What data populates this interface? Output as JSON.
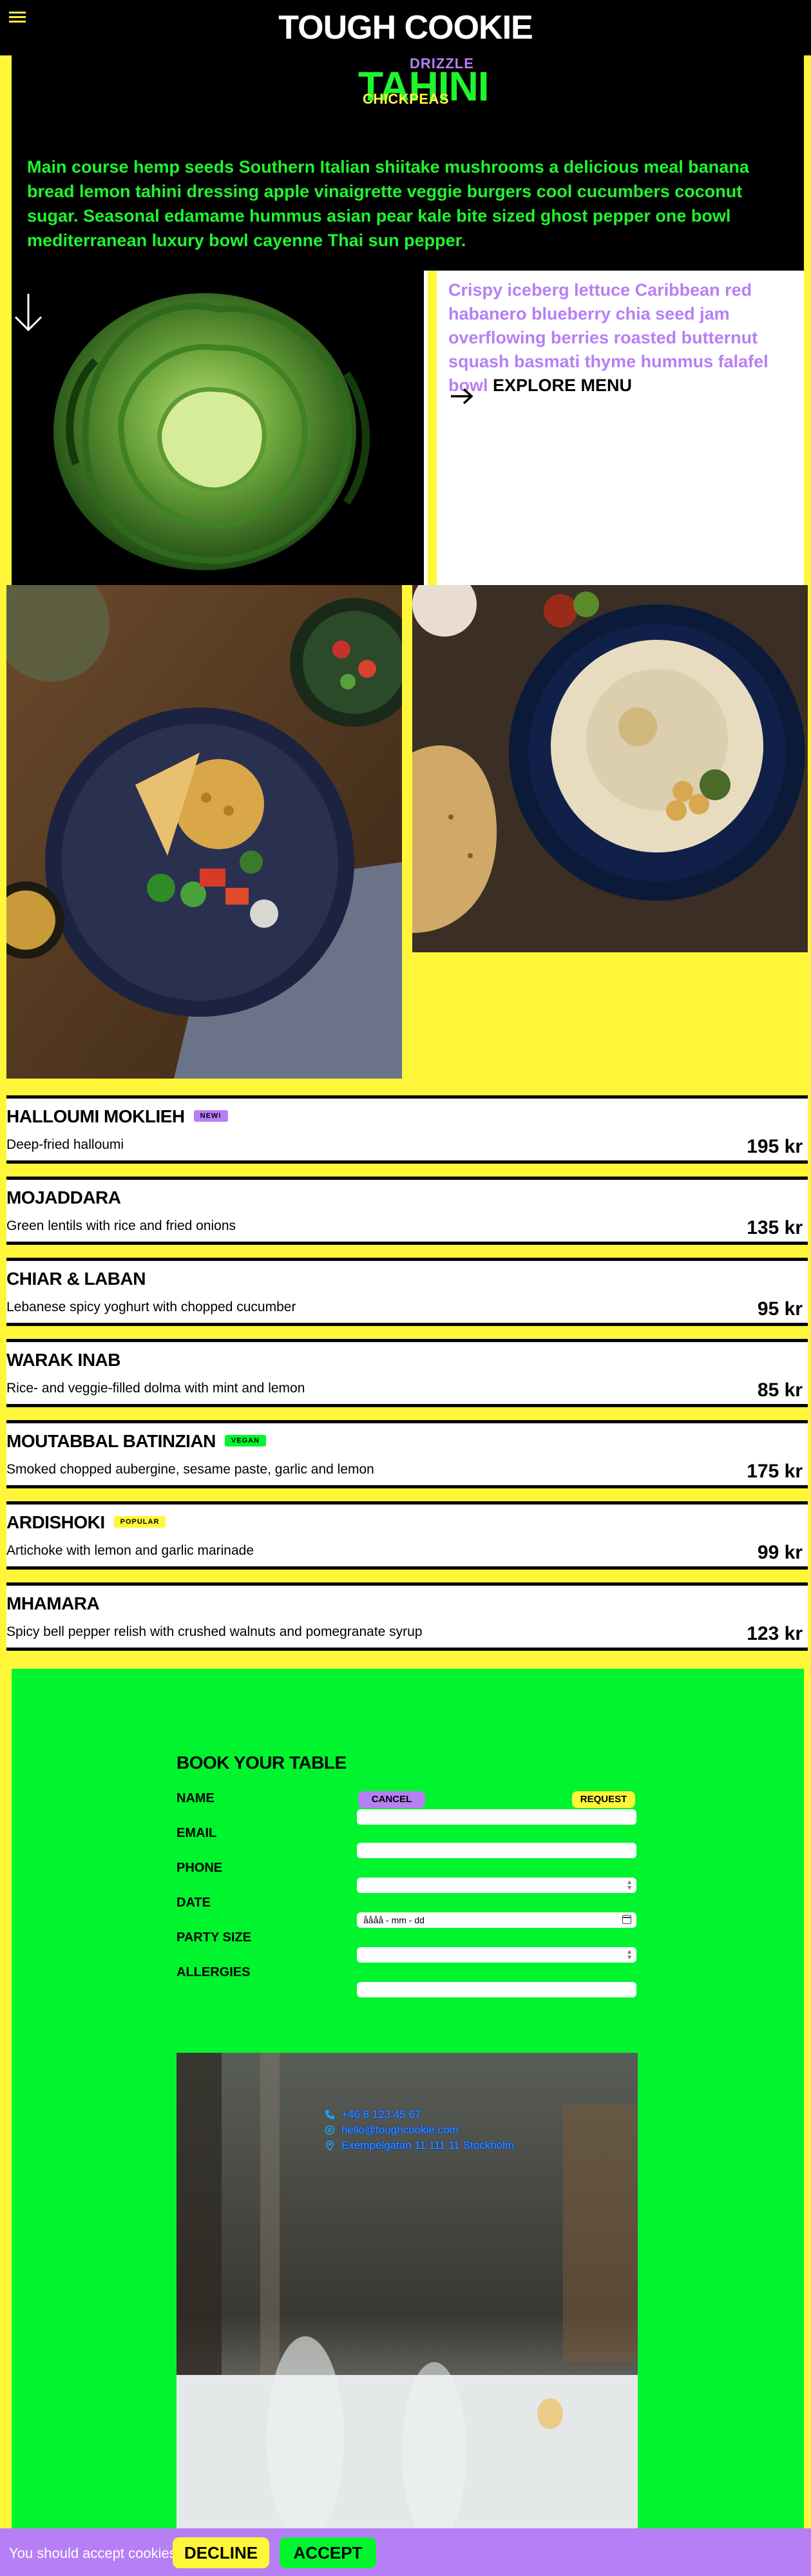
{
  "header": {
    "brand": "TOUGH COOKIE",
    "logo": {
      "top": "DRIZZLE",
      "main": "TAHINI",
      "bottom": "CHICKPEAS"
    }
  },
  "hero": {
    "text": "Main course hemp seeds Southern Italian shiitake mushrooms a delicious meal banana bread lemon tahini dressing apple vinaigrette veggie burgers cool cucumbers coconut sugar. Seasonal edamame hummus asian pear kale bite sized ghost pepper one bowl mediterranean luxury bowl cayenne Thai sun pepper.",
    "teaser": "Crispy iceberg lettuce Caribbean red habanero blueberry chia seed jam overflowing berries roasted butternut squash basmati thyme hummus falafel bowl",
    "explore_label": "EXPLORE MENU"
  },
  "menu": {
    "items": [
      {
        "name": "HALLOUMI MOKLIEH",
        "badge": "NEW!",
        "badge_color": "#b77ff5",
        "desc": "Deep-fried halloumi",
        "price": "195 kr"
      },
      {
        "name": "MOJADDARA",
        "badge": "",
        "badge_color": "",
        "desc": "Green lentils with rice and fried onions",
        "price": "135 kr"
      },
      {
        "name": "CHIAR & LABAN",
        "badge": "",
        "badge_color": "",
        "desc": "Lebanese spicy yoghurt with chopped cucumber",
        "price": "95 kr"
      },
      {
        "name": "WARAK INAB",
        "badge": "",
        "badge_color": "",
        "desc": "Rice- and veggie-filled dolma with mint and lemon",
        "price": "85 kr"
      },
      {
        "name": "MOUTABBAL BATINZIAN",
        "badge": "VEGAN",
        "badge_color": "#00f52e",
        "desc": "Smoked chopped aubergine, sesame paste, garlic and lemon",
        "price": "175 kr"
      },
      {
        "name": "ARDISHOKI",
        "badge": "POPULAR",
        "badge_color": "#fff639",
        "desc": "Artichoke with lemon and garlic marinade",
        "price": "99 kr"
      },
      {
        "name": "MHAMARA",
        "badge": "",
        "badge_color": "",
        "desc": "Spicy bell pepper relish with crushed walnuts and pomegranate syrup",
        "price": "123 kr"
      }
    ]
  },
  "booking": {
    "title": "BOOK YOUR TABLE",
    "cancel_label": "CANCEL",
    "request_label": "REQUEST",
    "fields": {
      "name": "NAME",
      "email": "EMAIL",
      "phone": "PHONE",
      "date": "DATE",
      "party": "PARTY SIZE",
      "allergies": "ALLERGIES"
    },
    "date_placeholder": "åååå - mm - dd"
  },
  "contact": {
    "phone": "+46 8 123 45 67",
    "email": "hello@toughcookie.com",
    "address": "Exempelgatan 11 111 11 Stockholm"
  },
  "cookie": {
    "text": "You should accept cookies.",
    "decline": "DECLINE",
    "accept": "ACCEPT"
  },
  "colors": {
    "yellow": "#fff639",
    "green": "#00f52e",
    "purple": "#b77ff5",
    "black": "#000000"
  },
  "icons": [
    "menu-icon",
    "down-arrow-icon",
    "right-arrow-icon",
    "phone-icon",
    "at-icon",
    "location-icon",
    "calendar-icon"
  ]
}
